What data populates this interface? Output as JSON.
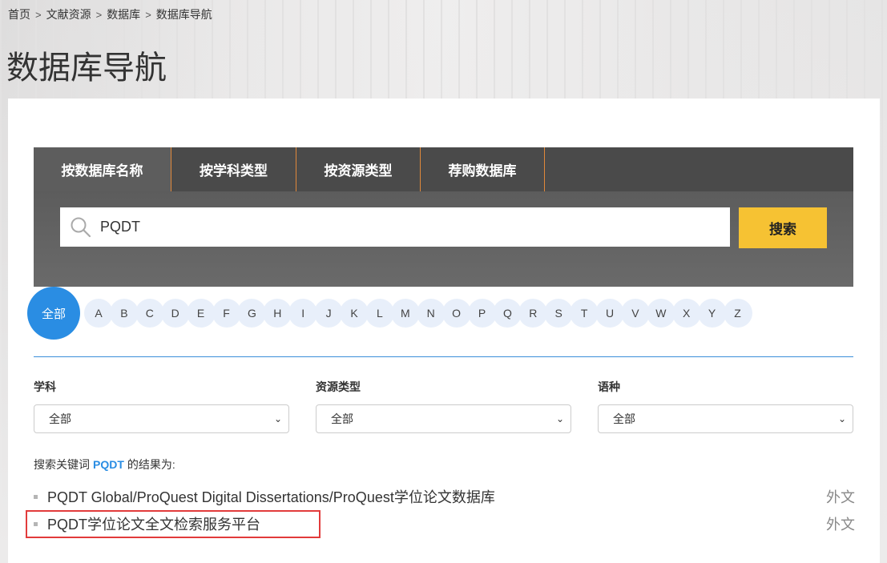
{
  "breadcrumb": [
    "首页",
    "文献资源",
    "数据库",
    "数据库导航"
  ],
  "page_title": "数据库导航",
  "tabs": [
    {
      "label": "按数据库名称",
      "active": true
    },
    {
      "label": "按学科类型",
      "active": false
    },
    {
      "label": "按资源类型",
      "active": false
    },
    {
      "label": "荐购数据库",
      "active": false
    }
  ],
  "search": {
    "value": "PQDT",
    "button": "搜索"
  },
  "alphabet": {
    "all": "全部",
    "letters": [
      "A",
      "B",
      "C",
      "D",
      "E",
      "F",
      "G",
      "H",
      "I",
      "J",
      "K",
      "L",
      "M",
      "N",
      "O",
      "P",
      "Q",
      "R",
      "S",
      "T",
      "U",
      "V",
      "W",
      "X",
      "Y",
      "Z"
    ]
  },
  "filters": [
    {
      "label": "学科",
      "value": "全部"
    },
    {
      "label": "资源类型",
      "value": "全部"
    },
    {
      "label": "语种",
      "value": "全部"
    }
  ],
  "result_summary": {
    "prefix": "搜索关键词",
    "keyword": "PQDT",
    "suffix": "的结果为:"
  },
  "results": [
    {
      "name": "PQDT Global/ProQuest Digital Dissertations/ProQuest学位论文数据库",
      "lang": "外文"
    },
    {
      "name": "PQDT学位论文全文检索服务平台",
      "lang": "外文"
    }
  ],
  "colors": {
    "accent": "#2a8de3",
    "button": "#f6c233",
    "highlight": "#e23b3b",
    "tab_divider": "#e0883a"
  }
}
